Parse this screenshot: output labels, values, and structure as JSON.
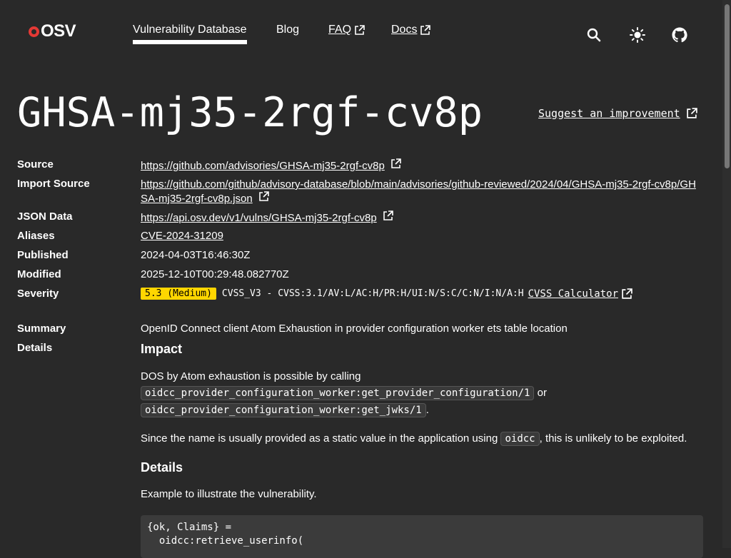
{
  "header": {
    "logo_text": "OSV",
    "nav": [
      {
        "label": "Vulnerability Database",
        "active": true,
        "external": false
      },
      {
        "label": "Blog",
        "active": false,
        "external": false
      },
      {
        "label": "FAQ",
        "active": false,
        "external": true
      },
      {
        "label": "Docs",
        "active": false,
        "external": true
      }
    ],
    "icons": [
      "search-icon",
      "theme-toggle-icon",
      "github-icon"
    ]
  },
  "title": "GHSA-mj35-2rgf-cv8p",
  "suggest_link": "Suggest an improvement",
  "details": {
    "source_label": "Source",
    "source_value": "https://github.com/advisories/GHSA-mj35-2rgf-cv8p",
    "import_label": "Import Source",
    "import_value": "https://github.com/github/advisory-database/blob/main/advisories/github-reviewed/2024/04/GHSA-mj35-2rgf-cv8p/GHSA-mj35-2rgf-cv8p.json",
    "json_label": "JSON Data",
    "json_value": "https://api.osv.dev/v1/vulns/GHSA-mj35-2rgf-cv8p",
    "aliases_label": "Aliases",
    "aliases_value": "CVE-2024-31209",
    "published_label": "Published",
    "published_value": "2024-04-03T16:46:30Z",
    "modified_label": "Modified",
    "modified_value": "2025-12-10T00:29:48.082770Z",
    "severity_label": "Severity",
    "severity_badge": "5.3 (Medium)",
    "severity_vector": "CVSS_V3 - CVSS:3.1/AV:L/AC:H/PR:H/UI:N/S:C/C:N/I:N/A:H",
    "severity_calc": "CVSS Calculator",
    "severity_color": "#ffd600",
    "summary_label": "Summary",
    "summary_value": "OpenID Connect client Atom Exhaustion in provider configuration worker ets table location",
    "details_label": "Details"
  },
  "content": {
    "impact_heading": "Impact",
    "impact_p1": "DOS by Atom exhaustion is possible by calling",
    "code1": "oidcc_provider_configuration_worker:get_provider_configuration/1",
    "or_text": "or",
    "code2": "oidcc_provider_configuration_worker:get_jwks/1",
    "period": ".",
    "impact_p2_a": "Since the name is usually provided as a static value in the application using",
    "code3": "oidcc",
    "impact_p2_b": ", this is unlikely to be exploited.",
    "details_heading": "Details",
    "details_p1": "Example to illustrate the vulnerability.",
    "code_block": "{ok, Claims} =\n  oidcc:retrieve_userinfo("
  }
}
